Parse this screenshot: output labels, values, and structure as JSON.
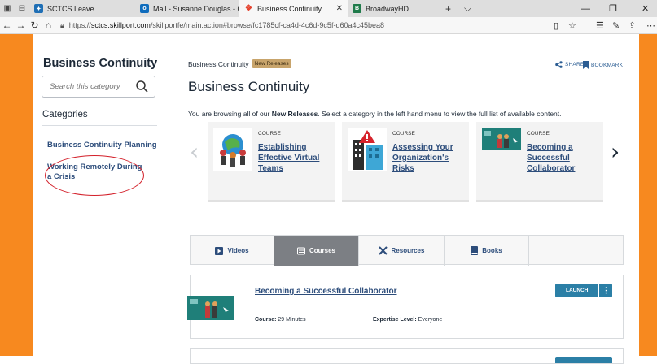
{
  "browser": {
    "tabs": [
      {
        "label": "SCTCS Leave",
        "fav_color": "#1f6fb5",
        "fav_letter": "",
        "active": false
      },
      {
        "label": "Mail - Susanne Douglas - O",
        "fav_color": "#0f6cbd",
        "fav_letter": "o",
        "active": false
      },
      {
        "label": "Business Continuity",
        "fav_color": "#e5432f",
        "fav_letter": "",
        "active": true
      },
      {
        "label": "BroadwayHD",
        "fav_color": "#1f7a4a",
        "fav_letter": "B",
        "active": false
      }
    ],
    "url_prefix": "https://",
    "url_host": "sctcs.skillport.com",
    "url_path": "/skillportfe/main.action#browse/fc1785cf-ca4d-4c6d-9c5f-d60a4c45bea8"
  },
  "sidebar": {
    "title": "Business Continuity",
    "search_placeholder": "Search this category",
    "categories_label": "Categories",
    "links": [
      "Business Continuity Planning",
      "Working Remotely During a Crisis"
    ]
  },
  "main": {
    "breadcrumb": "Business Continuity",
    "badge": "New Releases",
    "share_label": "SHARE",
    "bookmark_label": "BOOKMARK",
    "title": "Business Continuity",
    "browsing_pre": "You are browsing all of our ",
    "browsing_bold": "New Releases",
    "browsing_post": ". Select a category in the left hand menu to view the full list of available content.",
    "cards": [
      {
        "type": "COURSE",
        "title": "Establishing Effective Virtual Teams"
      },
      {
        "type": "COURSE",
        "title": "Assessing Your Organization's Risks"
      },
      {
        "type": "COURSE",
        "title": "Becoming a Successful Collaborator"
      }
    ],
    "content_tabs": [
      "Videos",
      "Courses",
      "Resources",
      "Books"
    ],
    "result": {
      "title": "Becoming a Successful Collaborator",
      "course_label": "Course:",
      "course_value": "29 Minutes",
      "level_label": "Expertise Level:",
      "level_value": "Everyone",
      "launch_label": "LAUNCH",
      "more_label": "⋮"
    }
  },
  "colors": {
    "accent_orange": "#f7891f",
    "link_blue": "#2d4d7b",
    "launch_blue": "#2b7fa6"
  }
}
